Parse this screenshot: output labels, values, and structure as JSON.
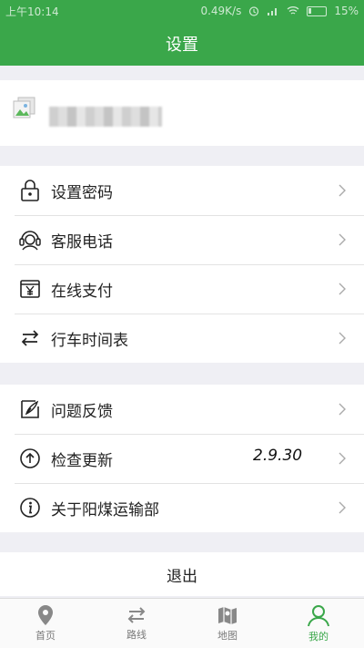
{
  "status_bar": {
    "time": "上午10:14",
    "speed": "0.49K/s",
    "battery": "15%"
  },
  "header": {
    "title": "设置"
  },
  "profile": {
    "avatar_icon": "image-placeholder-icon"
  },
  "menu_group_1": [
    {
      "label": "设置密码",
      "icon": "lock-icon"
    },
    {
      "label": "客服电话",
      "icon": "headset-icon"
    },
    {
      "label": "在线支付",
      "icon": "yen-payment-icon"
    },
    {
      "label": "行车时间表",
      "icon": "swap-arrows-icon"
    }
  ],
  "menu_group_2": [
    {
      "label": "问题反馈",
      "icon": "feedback-pen-icon"
    },
    {
      "label": "检查更新",
      "icon": "update-arrow-icon",
      "value": "2.9.30"
    },
    {
      "label": "关于阳煤运输部",
      "icon": "info-icon"
    }
  ],
  "logout_label": "退出",
  "tabbar": [
    {
      "label": "首页",
      "icon": "location-pin-icon",
      "active": false
    },
    {
      "label": "路线",
      "icon": "route-icon",
      "active": false
    },
    {
      "label": "地图",
      "icon": "map-icon",
      "active": false
    },
    {
      "label": "我的",
      "icon": "user-icon",
      "active": true
    }
  ],
  "colors": {
    "accent": "#3aa74a",
    "background": "#efeff4"
  }
}
